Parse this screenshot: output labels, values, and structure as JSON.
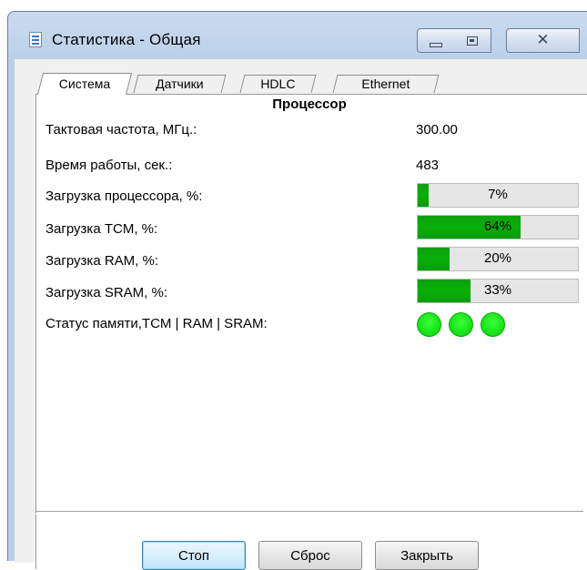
{
  "window": {
    "title": "Статистика - Общая"
  },
  "tabs": [
    {
      "label": "Система",
      "active": true
    },
    {
      "label": "Датчики",
      "active": false
    },
    {
      "label": "HDLC",
      "active": false
    },
    {
      "label": "Ethernet",
      "active": false
    }
  ],
  "section": {
    "title": "Процессор"
  },
  "rows": {
    "clock": {
      "label": "Тактовая частота, МГц.:",
      "value": "300.00"
    },
    "uptime": {
      "label": "Время работы, сек.:",
      "value": "483"
    },
    "cpu_load": {
      "label": "Загрузка процессора, %:",
      "text": "7%",
      "fraction": 0.07
    },
    "tcm_load": {
      "label": "Загрузка TCM, %:",
      "text": "64%",
      "fraction": 0.64
    },
    "ram_load": {
      "label": "Загрузка RAM, %:",
      "text": "20%",
      "fraction": 0.2
    },
    "sram_load": {
      "label": "Загрузка SRAM, %:",
      "text": "33%",
      "fraction": 0.33
    },
    "memory_status": {
      "label": "Статус памяти,TCM | RAM | SRAM:",
      "leds": [
        "ok",
        "ok",
        "ok"
      ]
    }
  },
  "buttons": {
    "stop": "Стоп",
    "reset": "Сброс",
    "close": "Закрыть"
  },
  "colors": {
    "bar_fill": "#08a808",
    "led_on": "#16e616",
    "default_button_border": "#3c7fb1"
  }
}
